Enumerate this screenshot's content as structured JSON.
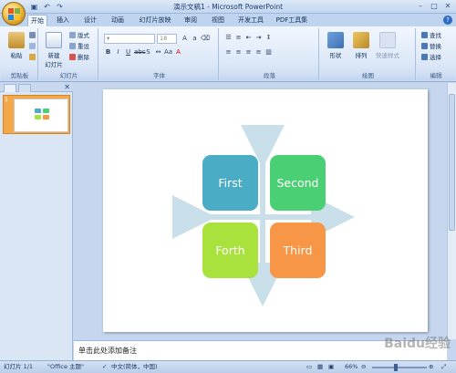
{
  "window": {
    "title": "演示文稿1 - Microsoft PowerPoint"
  },
  "quick_access": [
    {
      "icon": "save-icon",
      "glyph": "▣"
    },
    {
      "icon": "undo-icon",
      "glyph": "↶"
    },
    {
      "icon": "redo-icon",
      "glyph": "↷"
    }
  ],
  "tabs": [
    "开始",
    "插入",
    "设计",
    "动画",
    "幻灯片放映",
    "审阅",
    "视图",
    "开发工具",
    "PDF工具集"
  ],
  "ribbon": {
    "clipboard": {
      "label": "剪贴板",
      "paste": "粘贴"
    },
    "slides": {
      "label": "幻灯片",
      "new_slide": "新建\n幻灯片",
      "layout": "版式",
      "reset": "重设",
      "delete": "删除"
    },
    "font": {
      "label": "字体",
      "size": "18"
    },
    "paragraph": {
      "label": "段落"
    },
    "drawing": {
      "label": "绘图",
      "shape": "形状",
      "arrange": "排列",
      "quick_styles": "快速样式"
    },
    "editing": {
      "label": "编辑",
      "find": "查找",
      "replace": "替换",
      "select": "选择"
    }
  },
  "slide_pane": {
    "slide_number": "1"
  },
  "slide": {
    "boxes": [
      {
        "label": "First",
        "color": "#4bacc6"
      },
      {
        "label": "Second",
        "color": "#4bcf74"
      },
      {
        "label": "Forth",
        "color": "#a9e23d"
      },
      {
        "label": "Third",
        "color": "#f79646"
      }
    ]
  },
  "notes": {
    "placeholder": "单击此处添加备注"
  },
  "status": {
    "slide_info": "幻灯片 1/1",
    "theme": "\"Office 主题\"",
    "language": "中文(简体，中国)",
    "zoom": "66%"
  },
  "watermark": "Baidu经验"
}
